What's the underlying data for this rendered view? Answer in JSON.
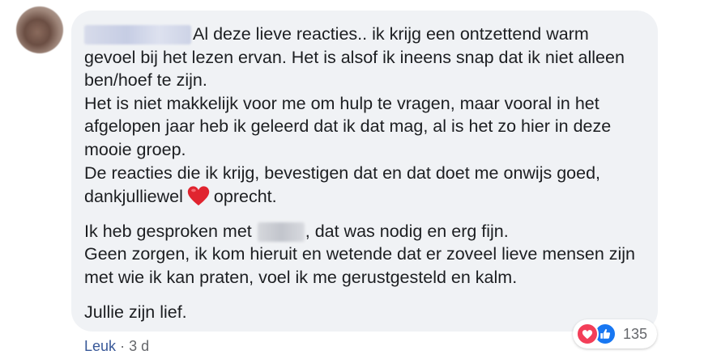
{
  "comment": {
    "first_line": "Al deze lieve reacties.. ik krijg een ontzettend warm",
    "p1_rest": "gevoel bij het lezen ervan. Het is alsof ik ineens snap dat ik niet alleen\nben/hoef te zijn.\nHet is niet makkelijk voor me om hulp te vragen, maar vooral in het\nafgelopen jaar heb ik geleerd dat ik dat mag, al is het zo hier in deze\nmooie groep.\nDe reacties die ik krijg, bevestigen dat en dat doet me onwijs goed,",
    "p1_last_a": "dankjulliewel",
    "p1_last_b": "oprecht.",
    "p2_a": "Ik heb gesproken met",
    "p2_b": ", dat was nodig en erg fijn.",
    "p2_rest": "Geen zorgen, ik kom hieruit en wetende dat er zoveel lieve mensen zijn\nmet wie ik kan praten, voel ik me gerustgesteld en kalm.",
    "p3": "Jullie zijn lief."
  },
  "reactions": {
    "icons": [
      "love-icon",
      "like-icon"
    ],
    "count": "135",
    "love_color": "#f33e58",
    "like_color": "#1877f2"
  },
  "actions": {
    "like_label": "Leuk",
    "separator": "·",
    "time": "3 d"
  },
  "colors": {
    "bubble_bg": "#f0f2f5",
    "text": "#1c1e21",
    "link": "#385898",
    "muted": "#65676b"
  }
}
